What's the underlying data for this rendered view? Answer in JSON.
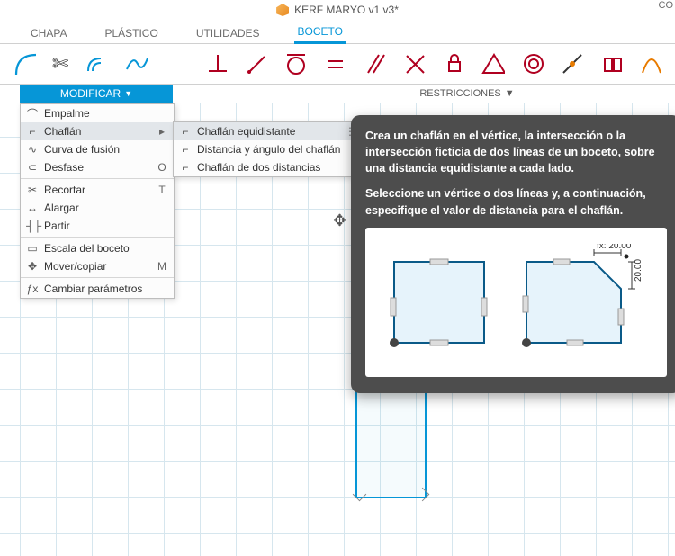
{
  "title": "KERF MARYO v1 v3*",
  "tabs": [
    "CHAPA",
    "PLÁSTICO",
    "UTILIDADES",
    "BOCETO"
  ],
  "active_tab": "BOCETO",
  "labels": {
    "modificar": "MODIFICAR",
    "restricciones": "RESTRICCIONES",
    "right_truncated": "CO"
  },
  "menu_modificar": [
    {
      "icon": "⌒",
      "label": "Empalme",
      "shortcut": ""
    },
    {
      "icon": "⌐",
      "label": "Chaflán",
      "shortcut": "▸",
      "hl": true
    },
    {
      "icon": "∿",
      "label": "Curva de fusión",
      "shortcut": ""
    },
    {
      "icon": "⊂",
      "label": "Desfase",
      "shortcut": "O"
    },
    {
      "sep": true
    },
    {
      "icon": "✂",
      "label": "Recortar",
      "shortcut": "T"
    },
    {
      "icon": "↔",
      "label": "Alargar",
      "shortcut": ""
    },
    {
      "icon": "┤├",
      "label": "Partir",
      "shortcut": ""
    },
    {
      "sep": true
    },
    {
      "icon": "▭",
      "label": "Escala del boceto",
      "shortcut": ""
    },
    {
      "icon": "✥",
      "label": "Mover/copiar",
      "shortcut": "M"
    },
    {
      "sep": true
    },
    {
      "icon": "ƒx",
      "label": "Cambiar parámetros",
      "shortcut": ""
    }
  ],
  "submenu_chaflan": [
    {
      "icon": "⌐",
      "label": "Chaflán equidistante",
      "hl": true,
      "dots": true
    },
    {
      "icon": "⌐",
      "label": "Distancia y ángulo del chaflán"
    },
    {
      "icon": "⌐",
      "label": "Chaflán de dos distancias"
    }
  ],
  "tooltip": {
    "p1": "Crea un chaflán en el vértice, la intersección o la intersección ficticia de dos líneas de un boceto, sobre una distancia equidistante a cada lado.",
    "p2": "Seleccione un vértice o dos líneas y, a continuación, especifique el valor de distancia para el chaflán.",
    "dim_label": "fx: 20.00",
    "dim_v": "20.00"
  }
}
